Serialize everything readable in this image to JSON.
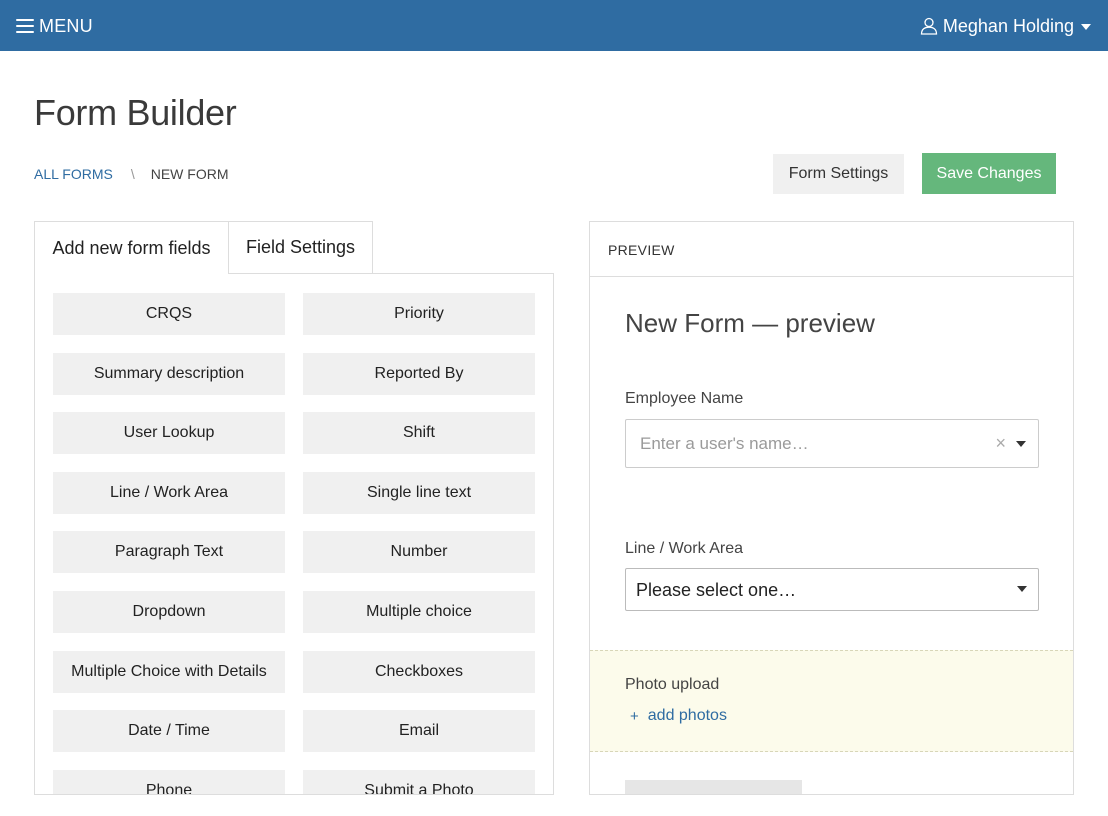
{
  "topbar": {
    "menu_label": "MENU",
    "user_name": "Meghan Holding",
    "background_color": "#2f6ca2"
  },
  "page": {
    "title": "Form Builder"
  },
  "breadcrumb": {
    "items": [
      "ALL FORMS",
      "NEW FORM"
    ],
    "separator": "\\"
  },
  "actions": {
    "form_settings_label": "Form Settings",
    "save_label": "Save Changes",
    "save_color": "#65b77c"
  },
  "tabs": [
    {
      "label": "Add new form fields",
      "active": true
    },
    {
      "label": "Field Settings",
      "active": false
    }
  ],
  "field_buttons": [
    "CRQS",
    "Priority",
    "Summary description",
    "Reported By",
    "User Lookup",
    "Shift",
    "Line / Work Area",
    "Single line text",
    "Paragraph Text",
    "Number",
    "Dropdown",
    "Multiple choice",
    "Multiple Choice with Details",
    "Checkboxes",
    "Date / Time",
    "Email",
    "Phone",
    "Submit a Photo"
  ],
  "preview": {
    "header_label": "PREVIEW",
    "title": "New Form — preview",
    "employee_field": {
      "label": "Employee Name",
      "placeholder": "Enter a user's name…",
      "clear_glyph": "×"
    },
    "work_area_field": {
      "label": "Line / Work Area",
      "selected": "Please select one…"
    },
    "photo_field": {
      "label": "Photo upload",
      "add_label": "add photos",
      "plus_glyph": "+",
      "background_color": "#fcfbeb"
    }
  },
  "icons": {
    "menu": "hamburger-icon",
    "user": "user-outline-icon",
    "dropdown": "caret-down-icon",
    "clear": "close-icon",
    "add": "plus-icon"
  }
}
